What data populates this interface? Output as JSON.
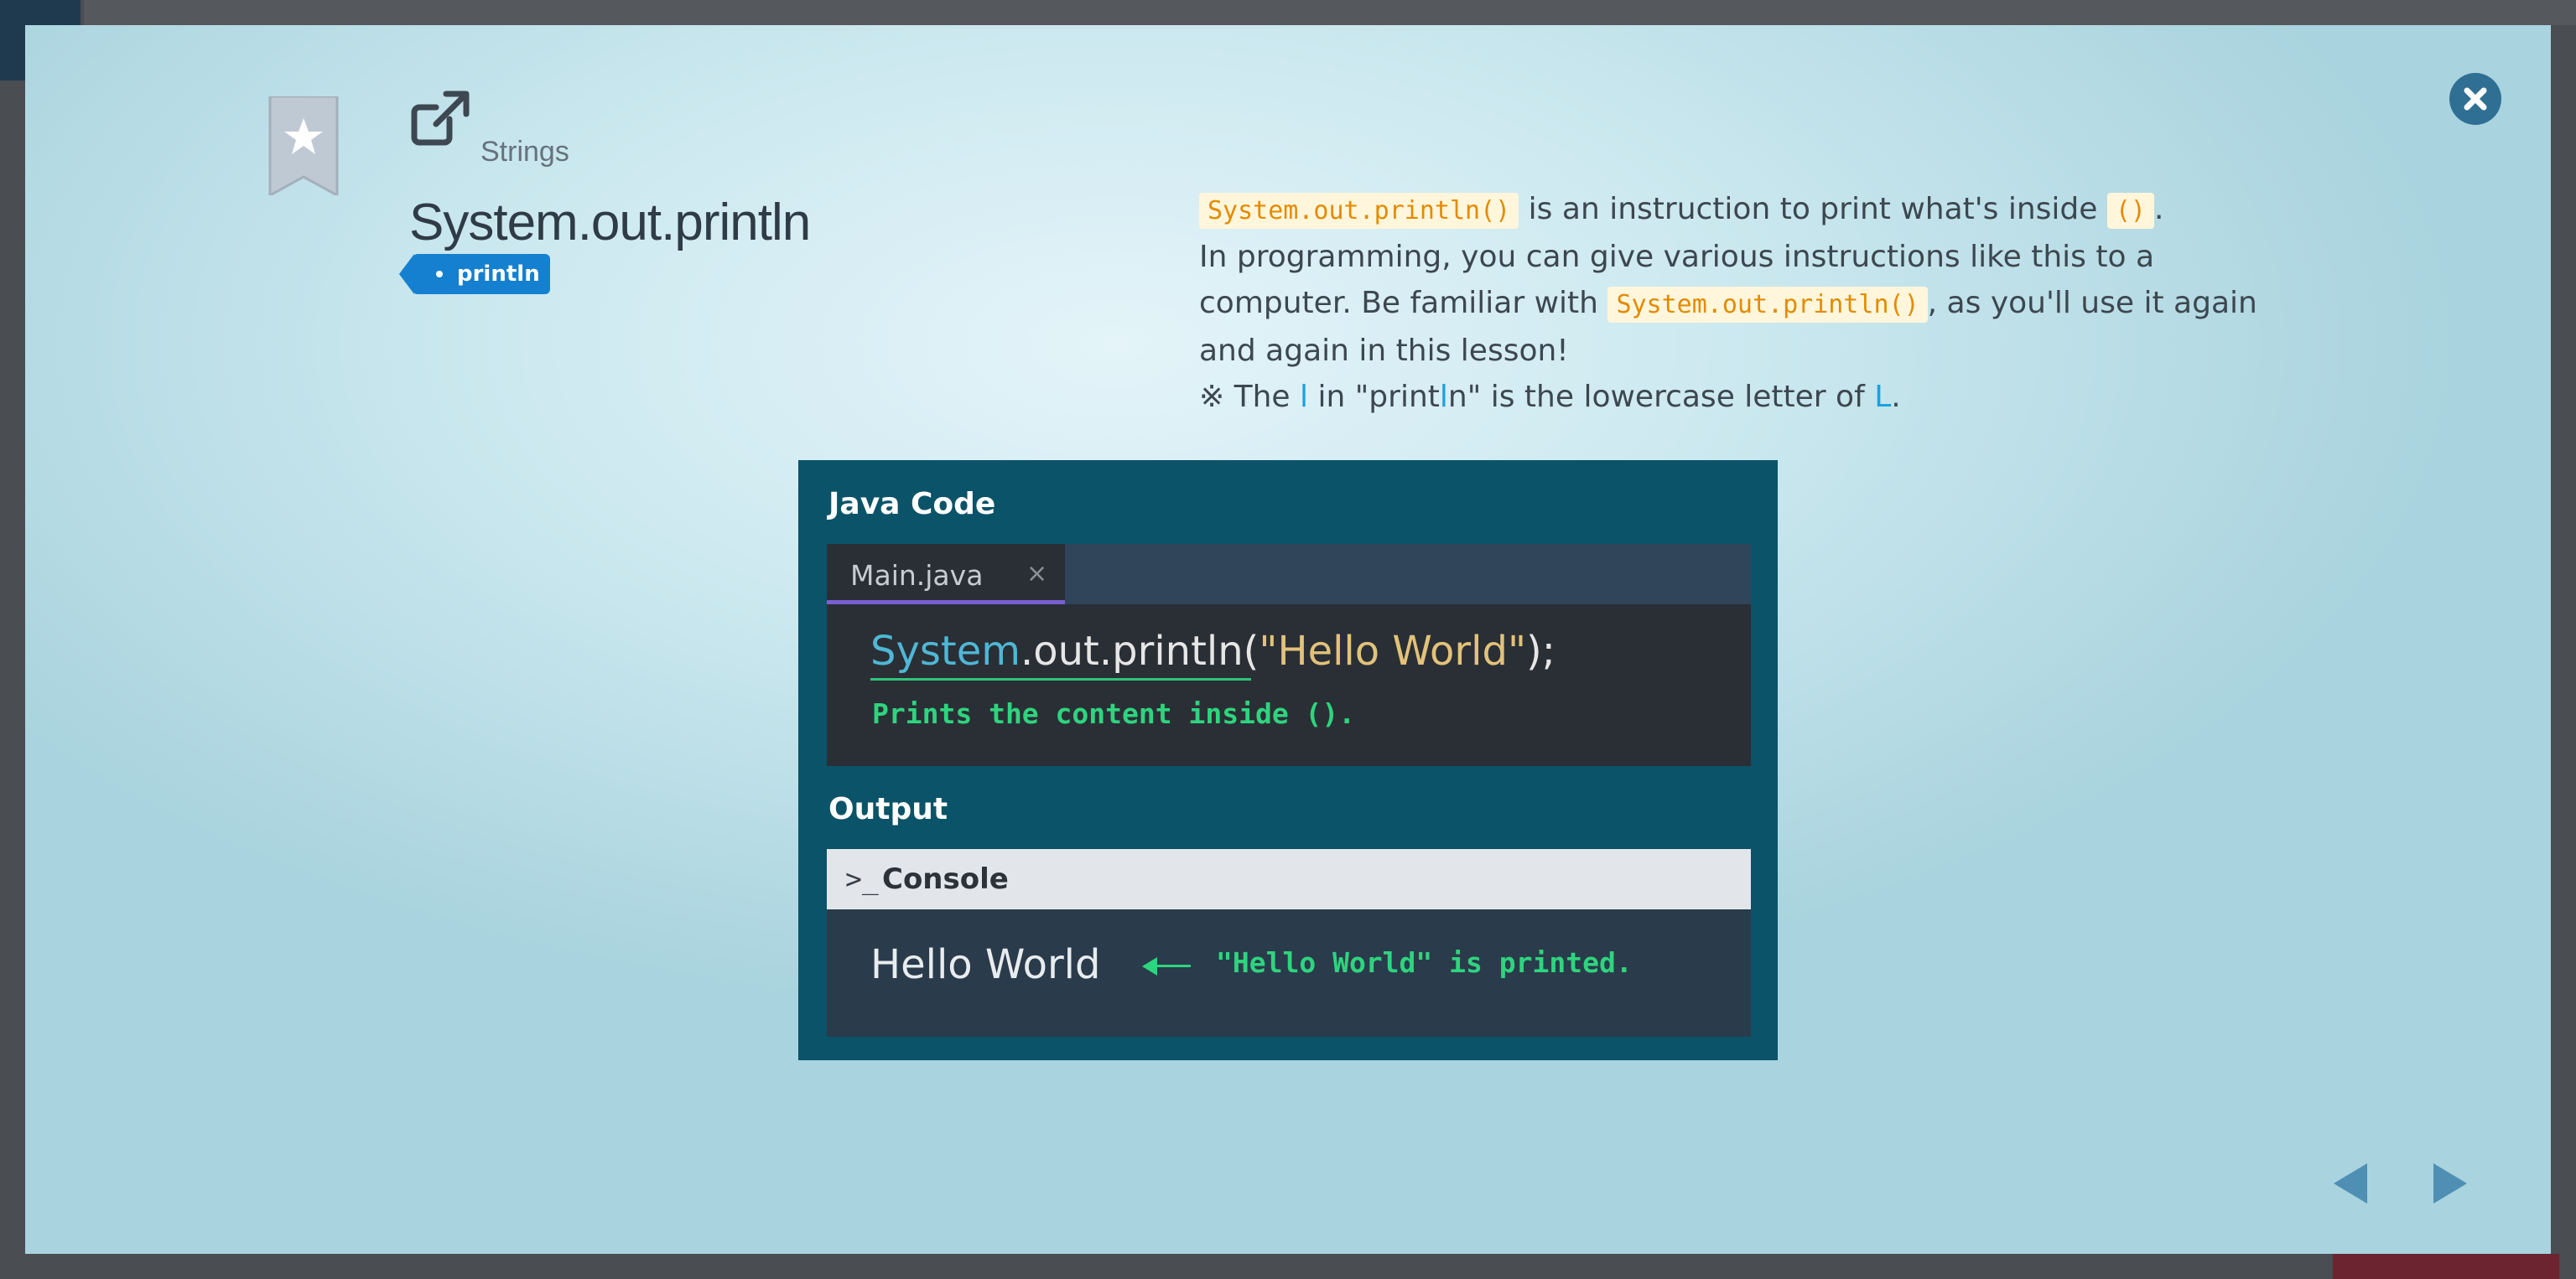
{
  "modal": {
    "category": "Strings",
    "title": "System.out.println",
    "tag": "println",
    "description": {
      "line1_code": "System.out.println()",
      "line1_text": " is an instruction to print what's inside ",
      "line1_code2": "()",
      "line1_end": ".",
      "line2": "In programming, you can give various instructions like this to a",
      "line3_start": "computer. Be familiar with ",
      "line3_code": "System.out.println()",
      "line3_end": ", as you'll use it again",
      "line4": "and again in this lesson!",
      "line5_a": "※ The ",
      "line5_l": "l",
      "line5_b": " in \"print",
      "line5_l2": "l",
      "line5_c": "n\" is the lowercase letter of ",
      "line5_L": "L",
      "line5_d": "."
    }
  },
  "slide": {
    "code_label": "Java Code",
    "file_tab": "Main.java",
    "file_tab_close": "×",
    "code_sys": "System",
    "code_rest": ".out.println(",
    "code_str": "\"Hello World\"",
    "code_end": ");",
    "code_note": "Prints the content inside ().",
    "output_label": "Output",
    "console_prompt": ">_",
    "console_label": "Console",
    "console_output": "Hello World",
    "output_note": "\"Hello World\" is printed."
  },
  "colors": {
    "accent": "#1580d0",
    "slide_bg": "#0b5368",
    "code_highlight": "#e38b00",
    "annotation": "#2fd47e"
  },
  "icons": {
    "close": "close-icon",
    "bookmark": "bookmark-star-icon",
    "share": "external-link-icon",
    "prev": "triangle-left-icon",
    "next": "triangle-right-icon"
  }
}
